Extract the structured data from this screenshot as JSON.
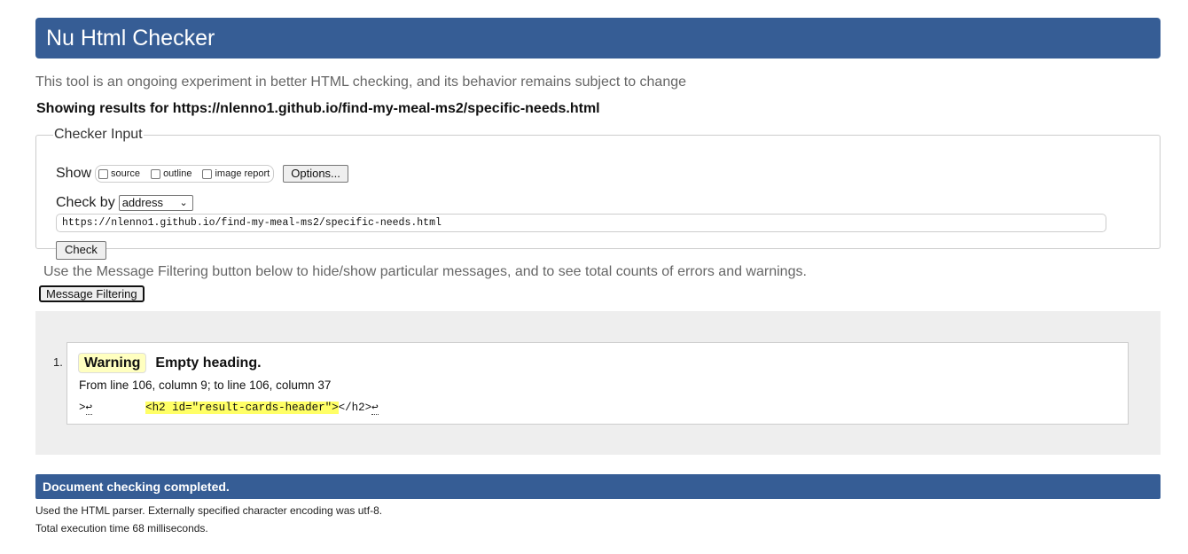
{
  "header": {
    "title": "Nu Html Checker"
  },
  "subtitle": "This tool is an ongoing experiment in better HTML checking, and its behavior remains subject to change",
  "results_for": "Showing results for https://nlenno1.github.io/find-my-meal-ms2/specific-needs.html",
  "checker_input": {
    "legend": "Checker Input",
    "show_label": "Show",
    "checkboxes": [
      {
        "label": "source"
      },
      {
        "label": "outline"
      },
      {
        "label": "image report"
      }
    ],
    "options_button": "Options...",
    "check_by_label": "Check by",
    "check_by_selected": "address",
    "url_value": "https://nlenno1.github.io/find-my-meal-ms2/specific-needs.html",
    "check_button": "Check"
  },
  "filter_note": "Use the Message Filtering button below to hide/show particular messages, and to see total counts of errors and warnings.",
  "filter_button": "Message Filtering",
  "messages": [
    {
      "number": "1.",
      "type": "Warning",
      "text": "Empty heading.",
      "location": "From line 106, column 9; to line 106, column 37",
      "extract_before": ">",
      "extract_lf1": "↩",
      "extract_spaces": "        ",
      "extract_highlight": "<h2 id=\"result-cards-header\">",
      "extract_after": "</h2>",
      "extract_lf2": "↩"
    }
  ],
  "status": "Document checking completed.",
  "footer": {
    "parser_note": "Used the HTML parser. Externally specified character encoding was utf-8.",
    "execution_time": "Total execution time 68 milliseconds."
  },
  "colors": {
    "brand": "#365d95",
    "warning_badge": "#ffffc0",
    "highlight": "#ffff66",
    "panel_bg": "#eeeeee"
  }
}
